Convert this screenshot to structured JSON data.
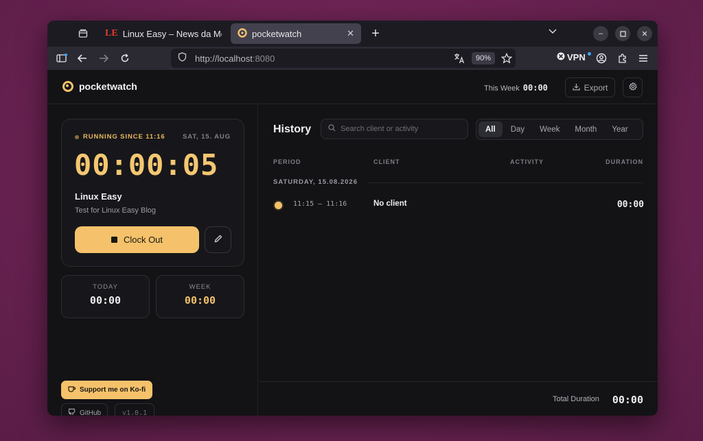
{
  "browser": {
    "tabs": [
      {
        "label": "Linux Easy – News da Mor",
        "favicon": "LE"
      },
      {
        "label": "pocketwatch",
        "active": true
      }
    ],
    "url": {
      "host": "http://localhost",
      "port": ":8080"
    },
    "zoom": "90%",
    "vpn_label": "VPN"
  },
  "app": {
    "brand": "pocketwatch",
    "header": {
      "this_week_label": "This Week",
      "this_week_value": "00:00",
      "export_label": "Export"
    },
    "timer": {
      "running_label": "RUNNING SINCE 11:16",
      "date": "SAT, 15. AUG",
      "elapsed": "00:00:05",
      "project": "Linux Easy",
      "description": "Test for Linux Easy Blog",
      "clock_out_label": "Clock Out"
    },
    "stats": {
      "today_label": "TODAY",
      "today_value": "00:00",
      "week_label": "WEEK",
      "week_value": "00:00"
    },
    "kofi_label": "Support me on Ko-fi",
    "github_label": "GitHub",
    "version": "v1.0.1",
    "history": {
      "title": "History",
      "search_placeholder": "Search client or activity",
      "filters": [
        "All",
        "Day",
        "Week",
        "Month",
        "Year"
      ],
      "active_filter": "All",
      "columns": [
        "PERIOD",
        "CLIENT",
        "ACTIVITY",
        "DURATION"
      ],
      "groups": [
        {
          "date": "SATURDAY, 15.08.2026",
          "entries": [
            {
              "period": "11:15 – 11:16",
              "client": "No client",
              "activity": "",
              "duration": "00:00"
            }
          ]
        }
      ]
    },
    "footer": {
      "total_label": "Total Duration",
      "total_value": "00:00"
    },
    "colors": {
      "accent": "#f5c26b",
      "background": "#131316",
      "surface": "#17171b"
    }
  }
}
